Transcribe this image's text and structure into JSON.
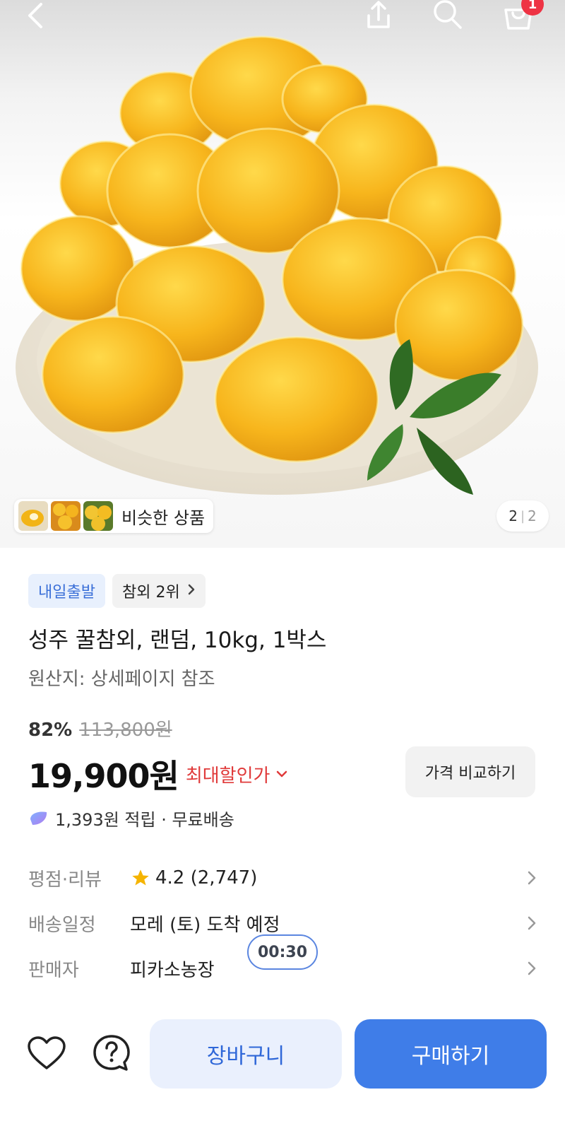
{
  "header": {
    "back_icon": "chevron-left-icon",
    "share_icon": "share-icon",
    "search_icon": "search-icon",
    "cart_icon": "shopping-bag-icon",
    "cart_badge": "1"
  },
  "gallery": {
    "similar_label": "비슷한 상품",
    "page_current": "2",
    "page_total": "2"
  },
  "product": {
    "tags": [
      {
        "label": "내일출발"
      },
      {
        "label": "참외 2위"
      }
    ],
    "title": "성주 꿀참외, 랜덤, 10kg, 1박스",
    "origin": "원산지: 상세페이지 참조",
    "discount_rate": "82%",
    "original_price": "113,800원",
    "price": "19,900원",
    "max_discount_label": "최대할인가",
    "compare_label": "가격 비교하기",
    "reward_text": "1,393원 적립 · 무료배송"
  },
  "details": {
    "rating_label": "평점·리뷰",
    "rating_value": "4.2 (2,747)",
    "shipping_label": "배송일정",
    "shipping_value": "모레 (토) 도착 예정",
    "seller_label": "판매자",
    "seller_value": "피카소농장"
  },
  "timer": "00:30",
  "actions": {
    "cart_label": "장바구니",
    "buy_label": "구매하기"
  },
  "colors": {
    "accent": "#3f7de8",
    "discount_red": "#e03a3a",
    "badge_red": "#ee3344"
  }
}
